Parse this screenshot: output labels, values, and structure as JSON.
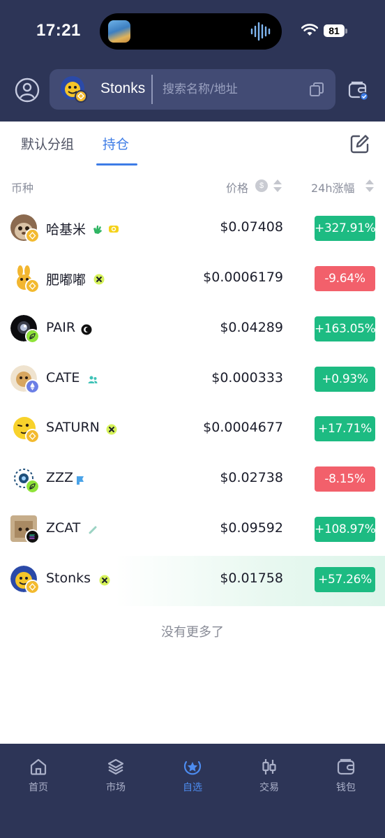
{
  "status_bar": {
    "time": "17:21",
    "battery": "81"
  },
  "search": {
    "token_name": "Stonks",
    "placeholder": "搜索名称/地址"
  },
  "tabs": [
    {
      "label": "默认分组",
      "active": false
    },
    {
      "label": "持仓",
      "active": true
    }
  ],
  "columns": {
    "coin": "币种",
    "price": "价格",
    "usd_symbol": "$",
    "change": "24h涨幅"
  },
  "colors": {
    "header_bg": "#2d3557",
    "up": "#1dbb82",
    "down": "#f2606b",
    "accent": "#3d7ce6"
  },
  "rows": [
    {
      "name": "哈基米",
      "price": "$0.07408",
      "change": "+327.91%",
      "direction": "up",
      "chain_icon": "bnb-chain-icon"
    },
    {
      "name": "肥嘟嘟",
      "price": "$0.0006179",
      "change": "-9.64%",
      "direction": "down",
      "chain_icon": "bnb-chain-icon"
    },
    {
      "name": "PAIR",
      "price": "$0.04289",
      "change": "+163.05%",
      "direction": "up",
      "chain_icon": "leaf-chain-icon"
    },
    {
      "name": "CATE",
      "price": "$0.000333",
      "change": "+0.93%",
      "direction": "up",
      "chain_icon": "ethereum-chain-icon"
    },
    {
      "name": "SATURN",
      "price": "$0.0004677",
      "change": "+17.71%",
      "direction": "up",
      "chain_icon": "bnb-chain-icon"
    },
    {
      "name": "ZZZ",
      "price": "$0.02738",
      "change": "-8.15%",
      "direction": "down",
      "chain_icon": "leaf-chain-icon"
    },
    {
      "name": "ZCAT",
      "price": "$0.09592",
      "change": "+108.97%",
      "direction": "up",
      "chain_icon": "solana-chain-icon"
    },
    {
      "name": "Stonks",
      "price": "$0.01758",
      "change": "+57.26%",
      "direction": "up",
      "chain_icon": "bnb-chain-icon"
    }
  ],
  "footer_text": "没有更多了",
  "nav": [
    {
      "label": "首页",
      "icon": "home-icon",
      "active": false
    },
    {
      "label": "市场",
      "icon": "layers-icon",
      "active": false
    },
    {
      "label": "自选",
      "icon": "star-icon",
      "active": true
    },
    {
      "label": "交易",
      "icon": "candlestick-icon",
      "active": false
    },
    {
      "label": "钱包",
      "icon": "wallet-icon",
      "active": false
    }
  ]
}
